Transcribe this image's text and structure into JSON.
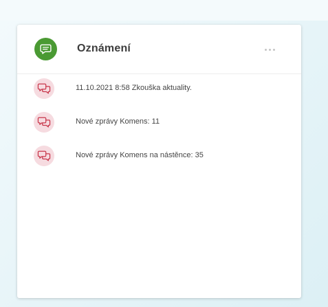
{
  "colors": {
    "accent_green": "#4a9a33",
    "item_icon_bg": "#f6dbe0",
    "item_icon_stroke": "#c8374b"
  },
  "card": {
    "title": "Oznámení",
    "header_icon": "chat-bubble-icon",
    "more_icon": "more-horizontal-icon",
    "items": [
      {
        "icon": "conversation-icon",
        "text": "11.10.2021 8:58 Zkouška aktuality."
      },
      {
        "icon": "conversation-icon",
        "text": "Nové zprávy Komens: 11"
      },
      {
        "icon": "conversation-icon",
        "text": "Nové zprávy Komens na nástěnce: 35"
      }
    ]
  }
}
